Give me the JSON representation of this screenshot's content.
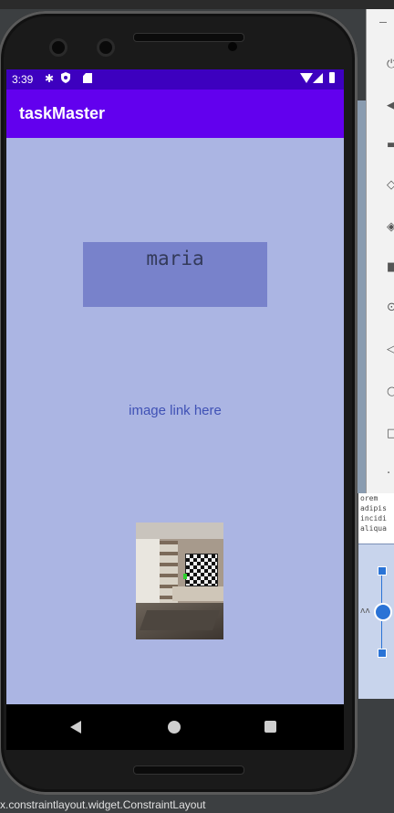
{
  "status_bar": {
    "time": "3:39"
  },
  "app": {
    "title": "taskMaster",
    "name_text": "maria",
    "image_link_text": "image link here",
    "background_color": "#abb5e3",
    "appbar_color": "#6200ee",
    "statusbar_color": "#3d00bf"
  },
  "ide": {
    "code_lines": [
      "orem",
      "adipis",
      "incidi",
      "aliqua"
    ],
    "status_text": "x.constraintlayout.widget.ConstraintLayout"
  },
  "icons": {
    "status_bar": [
      "gear-icon",
      "shield-icon",
      "sd-card-icon",
      "wifi-icon",
      "signal-icon",
      "battery-icon"
    ],
    "navigation": [
      "back-icon",
      "home-icon",
      "recents-icon"
    ]
  }
}
